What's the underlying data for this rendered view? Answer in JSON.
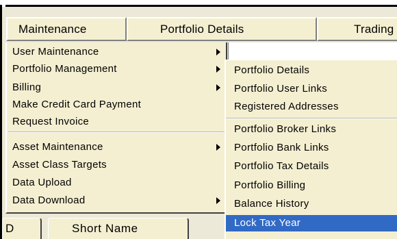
{
  "tabs": [
    {
      "label": "Maintenance"
    },
    {
      "label": "Portfolio Details"
    },
    {
      "label": "Trading"
    }
  ],
  "menu": {
    "items": [
      {
        "label": "User Maintenance",
        "has_submenu": true
      },
      {
        "label": "Portfolio Management",
        "has_submenu": true
      },
      {
        "label": "Billing",
        "has_submenu": true
      },
      {
        "label": "Make Credit Card Payment",
        "has_submenu": false
      },
      {
        "label": "Request Invoice",
        "has_submenu": false
      },
      {
        "label": "Asset Maintenance",
        "has_submenu": true
      },
      {
        "label": "Asset Class Targets",
        "has_submenu": false
      },
      {
        "label": "Data Upload",
        "has_submenu": false
      },
      {
        "label": "Data Download",
        "has_submenu": true
      }
    ]
  },
  "submenu": {
    "items": [
      {
        "label": "Portfolio Details"
      },
      {
        "label": "Portfolio User Links"
      },
      {
        "label": "Registered Addresses"
      },
      {
        "label": "Portfolio Broker Links"
      },
      {
        "label": "Portfolio Bank Links"
      },
      {
        "label": "Portfolio Tax Details"
      },
      {
        "label": "Portfolio Billing"
      },
      {
        "label": "Balance History"
      },
      {
        "label": "Lock Tax Year"
      }
    ],
    "highlighted_label": "Lock Tax Year",
    "highlight_color": "#316ac5"
  },
  "columns": [
    {
      "label": "D"
    },
    {
      "label": "Short Name"
    }
  ],
  "colors": {
    "menu_bg": "#f4efd1",
    "frame_bg": "#ece9d8",
    "highlight_text": "#ffffff"
  }
}
